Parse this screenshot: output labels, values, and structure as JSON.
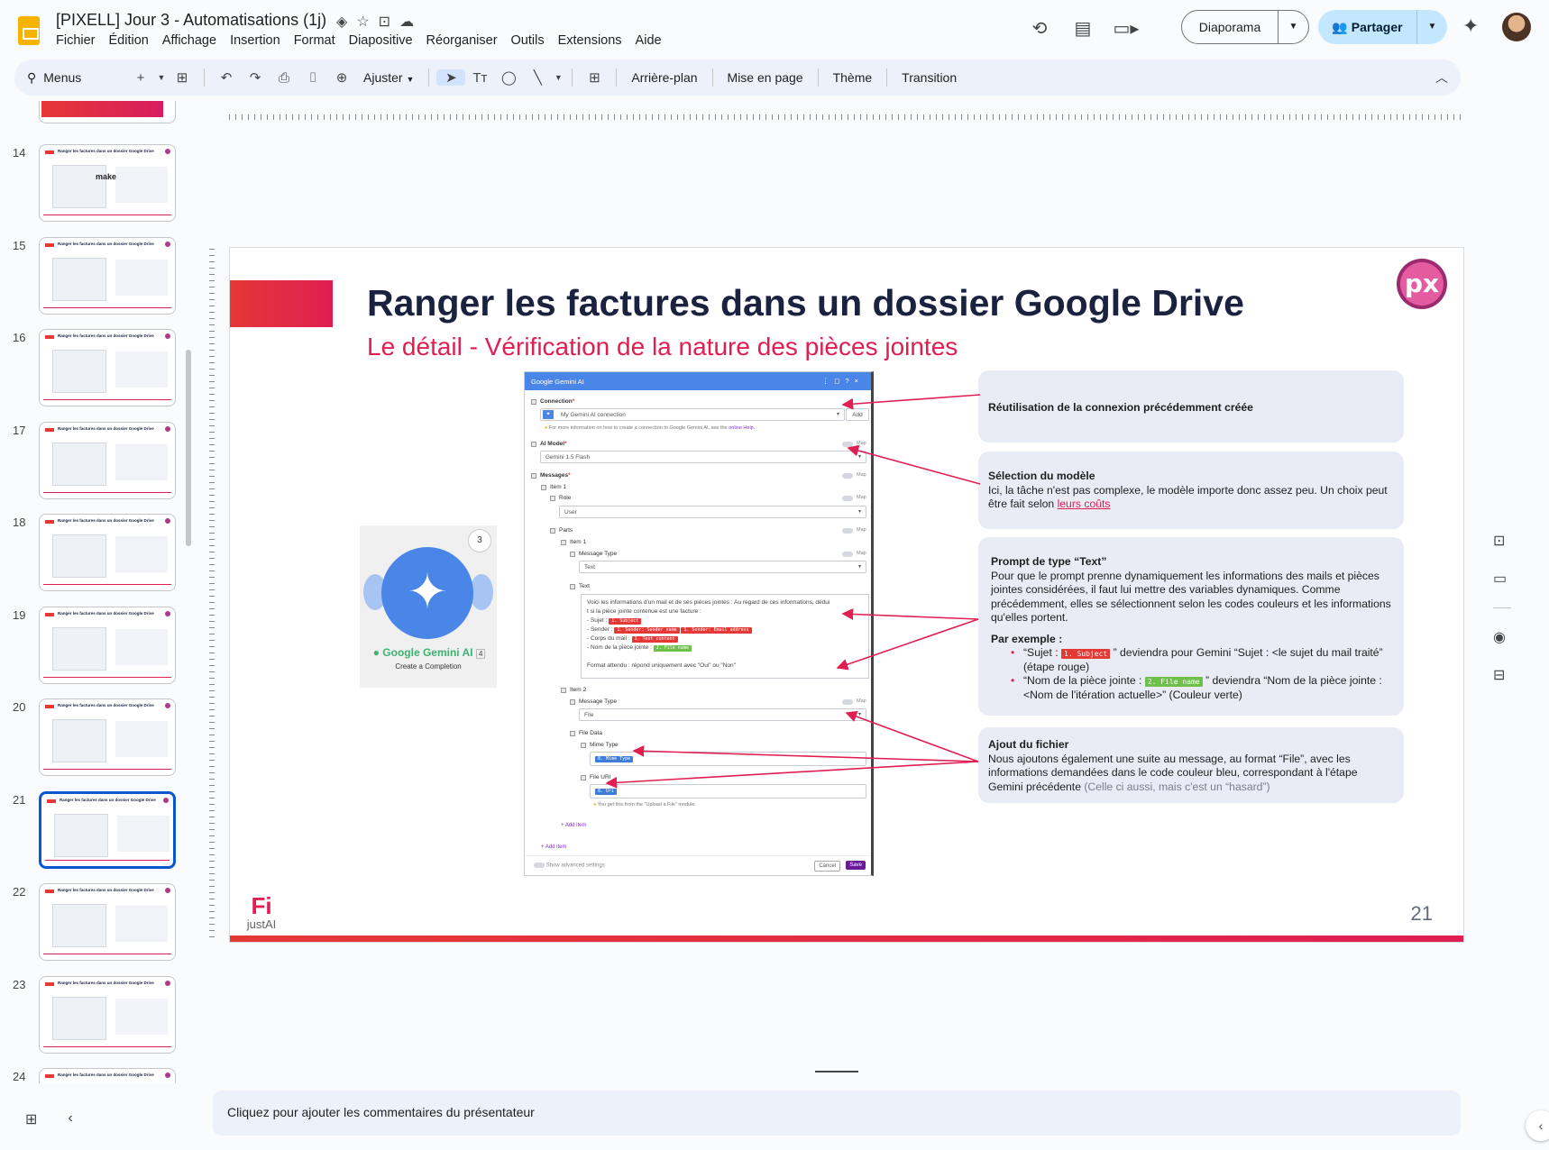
{
  "document": {
    "title": "[PIXELL] Jour 3 - Automatisations (1j)"
  },
  "menubar": [
    "Fichier",
    "Édition",
    "Affichage",
    "Insertion",
    "Format",
    "Diapositive",
    "Réorganiser",
    "Outils",
    "Extensions",
    "Aide"
  ],
  "header_actions": {
    "slideshow_label": "Diaporama",
    "share_label": "Partager"
  },
  "toolbar": {
    "search_label": "Menus",
    "zoom_label": "Ajuster",
    "background_label": "Arrière-plan",
    "layout_label": "Mise en page",
    "theme_label": "Thème",
    "transition_label": "Transition"
  },
  "filmstrip": {
    "slides": [
      {
        "number": "14",
        "title": "Ranger les factures dans un dossier Google Drive",
        "thumb_text": "make"
      },
      {
        "number": "15",
        "title": "Ranger les factures dans un dossier Google Drive",
        "thumb_text": ""
      },
      {
        "number": "16",
        "title": "Ranger les factures dans un dossier Google Drive",
        "thumb_text": ""
      },
      {
        "number": "17",
        "title": "Ranger les factures dans un dossier Google Drive",
        "thumb_text": ""
      },
      {
        "number": "18",
        "title": "Ranger les factures dans un dossier Google Drive",
        "thumb_text": ""
      },
      {
        "number": "19",
        "title": "Ranger les factures dans un dossier Google Drive",
        "thumb_text": ""
      },
      {
        "number": "20",
        "title": "Ranger les factures dans un dossier Google Drive",
        "thumb_text": ""
      },
      {
        "number": "21",
        "title": "Ranger les factures dans un dossier Google Drive",
        "thumb_text": ""
      },
      {
        "number": "22",
        "title": "Ranger les factures dans un dossier Google Drive",
        "thumb_text": ""
      },
      {
        "number": "23",
        "title": "Ranger les factures dans un dossier Google Drive",
        "thumb_text": ""
      },
      {
        "number": "24",
        "title": "Ranger les factures dans un dossier Google Drive",
        "thumb_text": ""
      }
    ],
    "active_slide": "21"
  },
  "slide": {
    "title": "Ranger les factures dans un dossier Google Drive",
    "subtitle": "Le détail - Vérification de la nature des pièces jointes",
    "logo_text": "px",
    "footer_brand": "justAI",
    "footer_mark": "Fi",
    "page_number": "21"
  },
  "gemini_module": {
    "badge": "3",
    "name": "Google Gemini AI",
    "count": "4",
    "operation": "Create a Completion"
  },
  "make_dialog": {
    "title": "Google Gemini AI",
    "connection_label": "Connection",
    "connection_value": "My Gemini AI connection",
    "add_button": "Add",
    "connection_hint": "For more information on how to create a connection to Google Gemini AI, see the",
    "connection_hint_link": "online Help.",
    "ai_model_label": "AI Model",
    "ai_model_value": "Gemini 1.5 Flash",
    "messages_label": "Messages",
    "item1_label": "Item 1",
    "role_label": "Role",
    "role_value": "User",
    "parts_label": "Parts",
    "part_item1_label": "Item 1",
    "message_type_label": "Message Type",
    "message_type_value_text": "Text",
    "text_label": "Text",
    "prompt_line1": "Voici les informations d'un mail et de ses pièces jointes : Au regard de ces informations, dédui",
    "prompt_line2": "t si la pièce jointe contenue est une facture :",
    "prompt_subject": "- Sujet :",
    "prompt_sender": "- Sender :",
    "prompt_body": "- Corps du mail :",
    "prompt_attachment": "- Nom de la pièce jointe :",
    "prompt_format": "Format attendu : répond uniquement avec \"Oui\" ou \"Non\"",
    "pill_subject": "1. Subject",
    "pill_sender_name": "1. Sender: Sender name",
    "pill_sender_email": "1. Sender: Email address",
    "pill_text_content": "1. Text content",
    "pill_file_name": "2. File name",
    "item2_label": "Item 2",
    "message_type_value_file": "File",
    "file_data_label": "File Data",
    "mime_type_label": "Mime Type",
    "pill_mime_type": "8. Mime Type",
    "file_uri_label": "File URI",
    "pill_uri": "8. Uri",
    "file_uri_hint": "You get this from the \"Upload a File\" module.",
    "add_item_inner": "+ Add item",
    "add_item_outer": "+ Add item",
    "map_label": "Map",
    "show_advanced": "Show advanced settings",
    "cancel_label": "Cancel",
    "save_label": "Save"
  },
  "callouts": {
    "reuse_connection": "Réutilisation de la connexion précédemment créée",
    "model_title": "Sélection du modèle",
    "model_body": "Ici, la tâche n'est pas complexe, le modèle importe donc assez peu. Un choix peut être fait selon",
    "model_link": "leurs coûts",
    "prompt_title": "Prompt de type “Text”",
    "prompt_body": "Pour que le prompt prenne dynamiquement les informations des mails et pièces jointes considérées, il faut lui mettre des variables dynamiques. Comme précédemment, elles se sélectionnent selon les codes couleurs et les informations qu'elles portent.",
    "example_title": "Par exemple :",
    "example1_prefix": "“Sujet :",
    "example1_pill": "1. Subject",
    "example1_suffix": "” deviendra pour Gemini “Sujet : <le sujet du mail traité” (étape rouge)",
    "example2_prefix": "“Nom de la pièce jointe :",
    "example2_pill": "2. File name",
    "example2_suffix": "” deviendra “Nom de la pièce jointe : <Nom de l'itération actuelle>” (Couleur verte)",
    "file_title": "Ajout du fichier",
    "file_body": "Nous ajoutons également une suite au message, au format “File”, avec les informations demandées dans le code couleur bleu, correspondant à l'étape Gemini précédente",
    "file_note": "(Celle ci aussi, mais c'est un “hasard”)"
  },
  "speaker_notes": {
    "placeholder": "Cliquez pour ajouter les commentaires du présentateur"
  },
  "colors": {
    "accent_red": "#e01e52",
    "title_navy": "#1a2240",
    "share_bg": "#c2e7ff",
    "make_blue": "#4a86e8"
  }
}
